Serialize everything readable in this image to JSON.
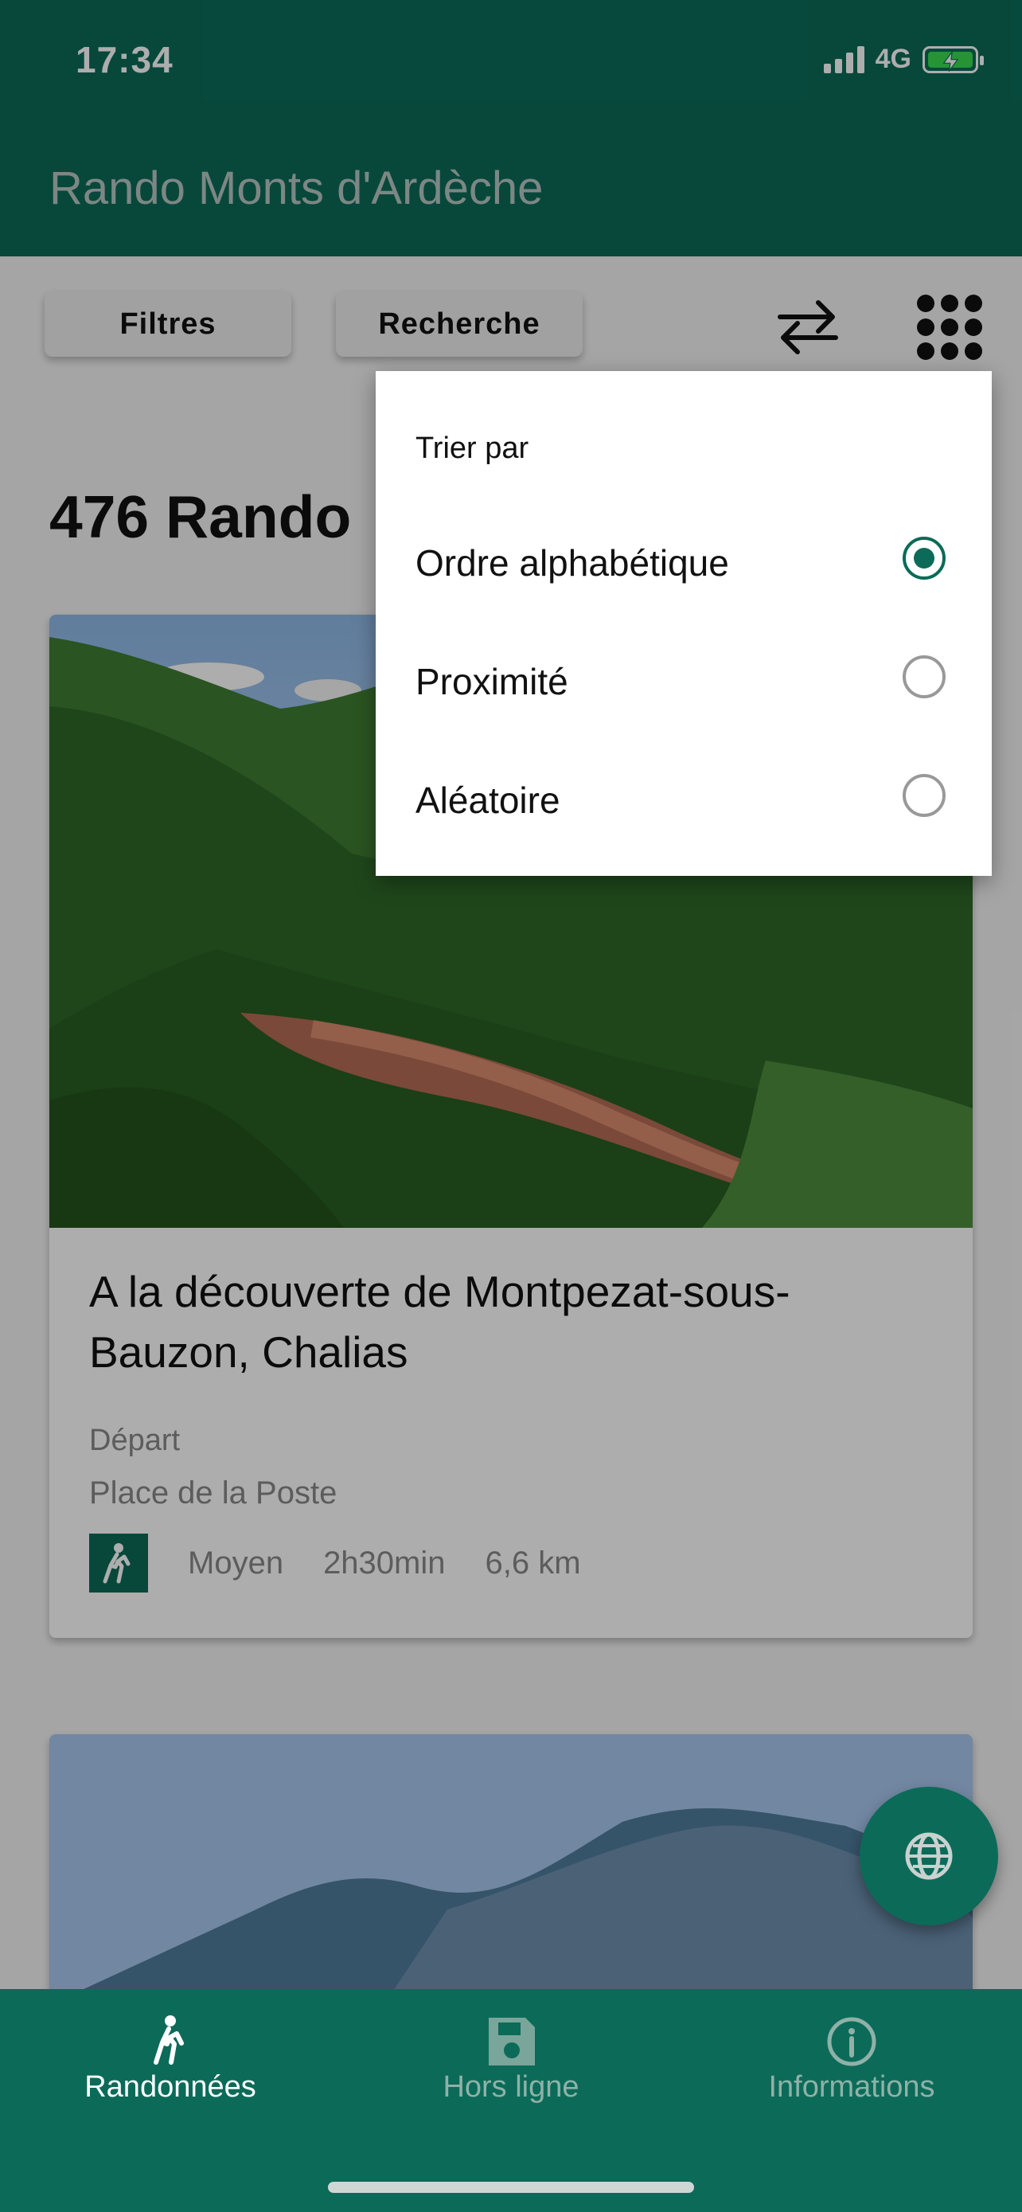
{
  "status_bar": {
    "time": "17:34",
    "network": "4G"
  },
  "app_bar": {
    "title": "Rando Monts d'Ardèche"
  },
  "toolbar": {
    "filters_label": "Filtres",
    "search_label": "Recherche",
    "sort_icon": "swap-arrows-icon",
    "grid_icon": "apps-grid-icon"
  },
  "list": {
    "count_text": "476 Rando"
  },
  "card": {
    "title": "A la découverte de Montpezat-sous-Bauzon, Chalias",
    "depart_label": "Départ",
    "depart_place": "Place de la Poste",
    "difficulty": "Moyen",
    "duration": "2h30min",
    "distance": "6,6 km"
  },
  "sort_menu": {
    "title": "Trier par",
    "options": [
      {
        "label": "Ordre alphabétique",
        "selected": true
      },
      {
        "label": "Proximité",
        "selected": false
      },
      {
        "label": "Aléatoire",
        "selected": false
      }
    ]
  },
  "bottom_nav": {
    "items": [
      {
        "label": "Randonnées",
        "icon": "hiker-icon"
      },
      {
        "label": "Hors ligne",
        "icon": "save-icon"
      },
      {
        "label": "Informations",
        "icon": "info-icon"
      }
    ]
  },
  "fab": {
    "icon": "globe-icon"
  },
  "colors": {
    "primary": "#0b6b58",
    "background": "#f4f4f4",
    "card": "#ffffff"
  }
}
